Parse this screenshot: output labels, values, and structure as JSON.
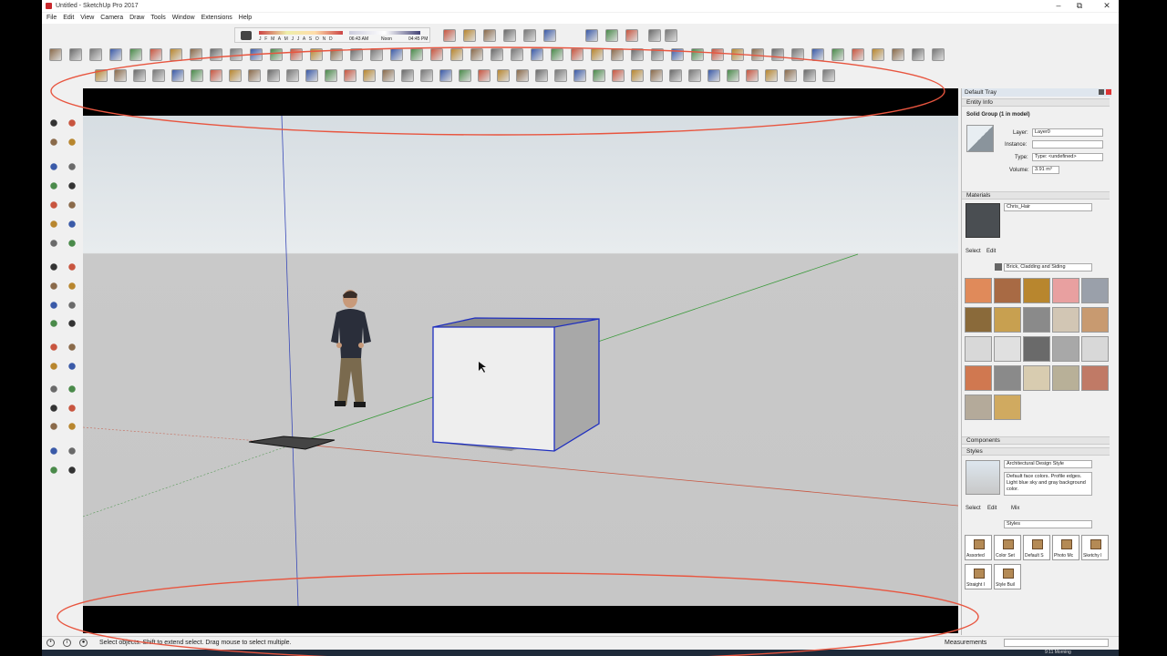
{
  "window": {
    "title": "Untitled - SketchUp Pro 2017",
    "minimize": "–",
    "maximize": "⧉",
    "close": "✕"
  },
  "menu": [
    "File",
    "Edit",
    "View",
    "Camera",
    "Draw",
    "Tools",
    "Window",
    "Extensions",
    "Help"
  ],
  "shadow_settings": {
    "months": "J F M A M J J A S O N D",
    "time_start": "06:43 AM",
    "noon": "Noon",
    "time_end": "04:45 PM"
  },
  "colors": {
    "brand": "#c8282d",
    "selection": "#1f2fbf",
    "highlight_ellipse": "#e8553f",
    "sky": "#d6dde2",
    "ground": "#c6c6c6"
  },
  "tray": {
    "title": "Default Tray",
    "entity_info": {
      "header": "Entity Info",
      "selection": "Solid Group (1 in model)",
      "layer_label": "Layer:",
      "layer_value": "Layer0",
      "instance_label": "Instance:",
      "instance_value": "",
      "type_label": "Type:",
      "type_value": "Type: <undefined>",
      "volume_label": "Volume:",
      "volume_value": "3.91 m³"
    },
    "materials": {
      "header": "Materials",
      "current_material": "Chris_Hair",
      "tab_select": "Select",
      "tab_edit": "Edit",
      "library": "Brick, Cladding and Siding",
      "swatch_colors": [
        "#e08a5a",
        "#a86a44",
        "#b8862e",
        "#e8a0a0",
        "#9aa0aa",
        "#8a6a3a",
        "#c8a050",
        "#8a8a8a",
        "#d2c6b4",
        "#c89a70",
        "#d8d8d8",
        "#e0e0e0",
        "#6a6a6a",
        "#a8a8a8",
        "#d8d8d8",
        "#d07850",
        "#8a8a8a",
        "#d8ccb0",
        "#b8b098",
        "#c07a66",
        "#b4aa9a",
        "#d0aa60"
      ]
    },
    "components": {
      "header": "Components"
    },
    "styles": {
      "header": "Styles",
      "style_name": "Architectural Design Style",
      "style_desc": "Default face colors. Profile edges. Light blue sky and gray background color.",
      "tab_select": "Select",
      "tab_edit": "Edit",
      "tab_mix": "Mix",
      "collection": "Styles",
      "thumbs": [
        "Assorted",
        "Color Set",
        "Default S",
        "Photo Mc",
        "Sketchy I",
        "Straight I",
        "Style Buil"
      ]
    }
  },
  "status": {
    "message": "Select objects. Shift to extend select. Drag mouse to select multiple.",
    "measurements_label": "Measurements"
  },
  "taskbar": {
    "clock": "9:11 Morning"
  },
  "toolbar_icon_names": [
    "new",
    "open",
    "save",
    "print",
    "cut",
    "copy",
    "paste",
    "erase",
    "undo",
    "redo"
  ]
}
